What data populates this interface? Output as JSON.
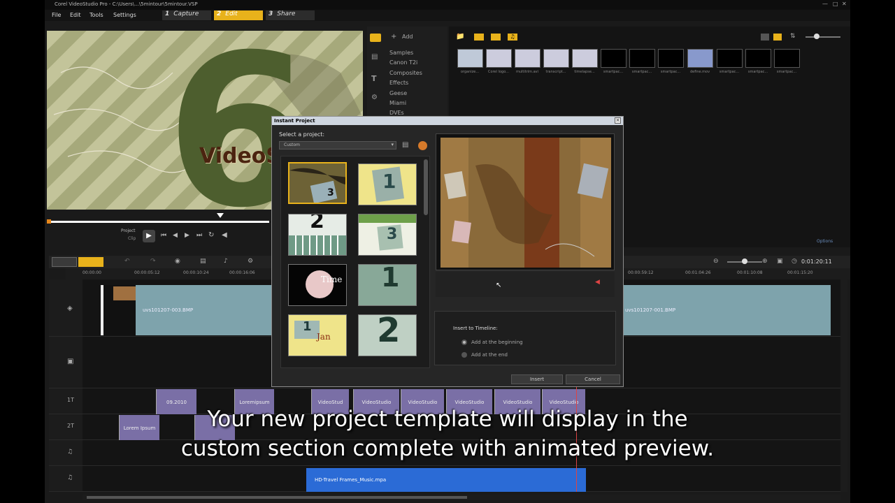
{
  "window": {
    "title": "Corel VideoStudio Pro - C:\\Users\\...\\5mintour\\5mintour.VSP"
  },
  "menu": [
    "File",
    "Edit",
    "Tools",
    "Settings"
  ],
  "steps": [
    {
      "num": "1",
      "label": "Capture"
    },
    {
      "num": "2",
      "label": "Edit"
    },
    {
      "num": "3",
      "label": "Share"
    }
  ],
  "preview": {
    "big_digit": "6",
    "overlay_text": "VideoS"
  },
  "controls": {
    "project_label": "Project",
    "clip_label": "Clip"
  },
  "library": {
    "add_label": "Add",
    "categories": [
      "Samples",
      "Canon T2i",
      "Composites",
      "Effects",
      "Geese",
      "Miami",
      "DVEs"
    ],
    "thumbs": [
      "organize...",
      "Corel logo...",
      "multitrim.avi",
      "transcript...",
      "timelapse...",
      "smartpac...",
      "smartpac...",
      "smartpac...",
      "define.mov",
      "smartpac...",
      "smartpac...",
      "smartpac..."
    ],
    "options_label": "Options"
  },
  "timeline": {
    "timecode": "0:01:20:11",
    "ruler": [
      "00:00:00",
      "00:00:05:12",
      "00:00:10:24",
      "00:00:16:06",
      "00:00:59:12",
      "00:01:04:26",
      "00:01:10:08",
      "00:01:15:20"
    ],
    "video_clips": [
      "uvs101207-003.BMP",
      "uvs101207-001.BMP"
    ],
    "title1_clips": [
      "09.2010",
      "Loremipsum",
      "VideoStud",
      "VideoStudio",
      "VideoStudio",
      "VideoStudio",
      "VideoStudio",
      "VideoStudio"
    ],
    "title2_clips": [
      "Lorem Ipsum"
    ],
    "music_clip": "HD-Travel Frames_Music.mpa",
    "track_labels": [
      "1T",
      "2T"
    ]
  },
  "dialog": {
    "title": "Instant Project",
    "select_label": "Select a project:",
    "dropdown_value": "Custom",
    "tile_texts": [
      "3",
      "1",
      "2",
      "3",
      "Time",
      "1",
      "Jan",
      "2"
    ],
    "insert_heading": "Insert to Timeline:",
    "options": [
      "Add at the beginning",
      "Add at the end"
    ],
    "selected_option": 0,
    "insert_button": "Insert",
    "cancel_button": "Cancel"
  },
  "subtitle": {
    "line1": "Your new project template will display in the",
    "line2": "custom section complete with animated preview."
  },
  "colors": {
    "accent": "#e8b21b",
    "video_clip": "#7ea3ac",
    "title_clip": "#7a6fa6",
    "music_clip": "#2b6bd6"
  }
}
